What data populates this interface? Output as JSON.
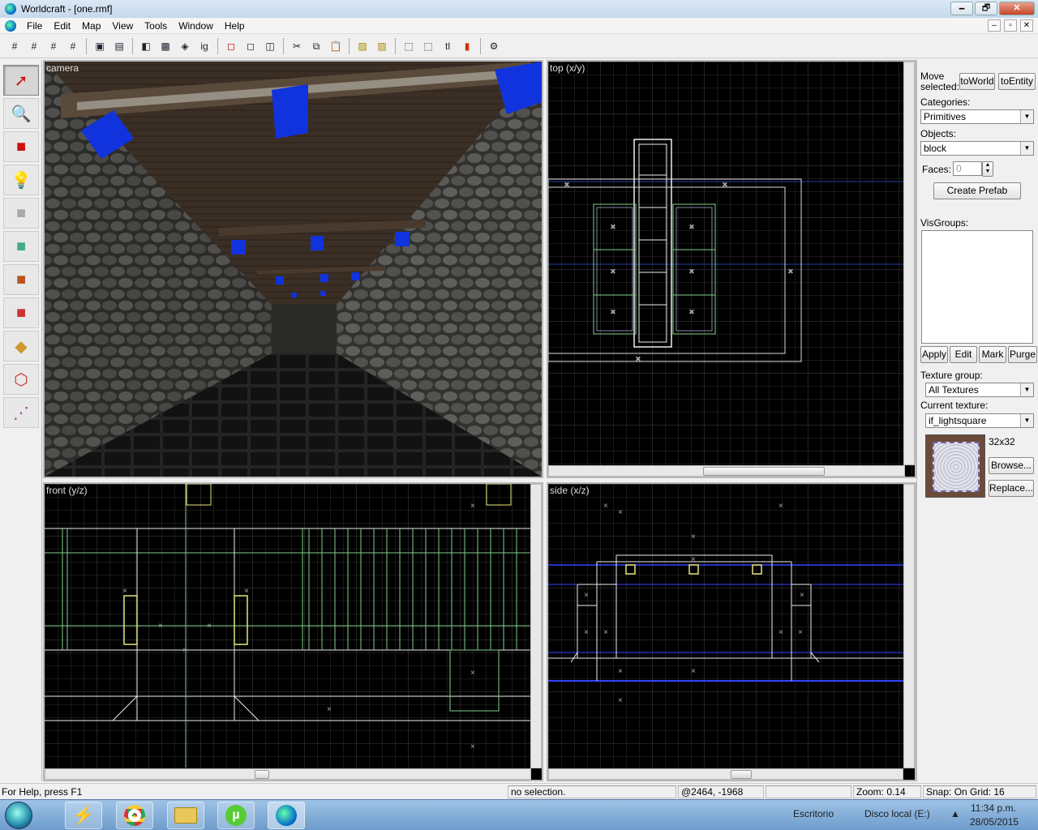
{
  "window": {
    "title": "Worldcraft - [one.rmf]",
    "minimize": "🗕",
    "maximize": "🗗",
    "close": "✕"
  },
  "menu": {
    "items": [
      "File",
      "Edit",
      "Map",
      "View",
      "Tools",
      "Window",
      "Help"
    ],
    "mdi_min": "–",
    "mdi_max": "▫",
    "mdi_close": "✕"
  },
  "viewports": {
    "camera": "camera",
    "top": "top (x/y)",
    "front": "front (y/z)",
    "side": "side (x/z)"
  },
  "panel": {
    "move_selected": "Move selected:",
    "to_world": "toWorld",
    "to_entity": "toEntity",
    "categories_label": "Categories:",
    "categories_value": "Primitives",
    "objects_label": "Objects:",
    "objects_value": "block",
    "faces_label": "Faces:",
    "faces_value": "0",
    "create_prefab": "Create Prefab",
    "visgroups_label": "VisGroups:",
    "apply": "Apply",
    "edit": "Edit",
    "mark": "Mark",
    "purge": "Purge",
    "texture_group_label": "Texture group:",
    "texture_group_value": "All Textures",
    "current_texture_label": "Current texture:",
    "current_texture_value": "if_lightsquare",
    "texture_size": "32x32",
    "browse": "Browse...",
    "replace": "Replace..."
  },
  "status": {
    "help": "For Help, press F1",
    "selection": "no selection.",
    "coords": "@2464, -1968",
    "zoom": "Zoom: 0.14",
    "snap": "Snap: On Grid: 16"
  },
  "tray": {
    "toolbar1": "Escritorio",
    "toolbar2": "Disco local (E:)",
    "time": "11:34 p.m.",
    "date": "28/05/2015"
  },
  "colors": {
    "grid": "#2a2a2a",
    "grid_major": "#3a3a3a",
    "brush_white": "#e8e8e8",
    "brush_green": "#7fd08a",
    "brush_blue": "#3344ff",
    "entity_yellow": "#e5e57a"
  }
}
